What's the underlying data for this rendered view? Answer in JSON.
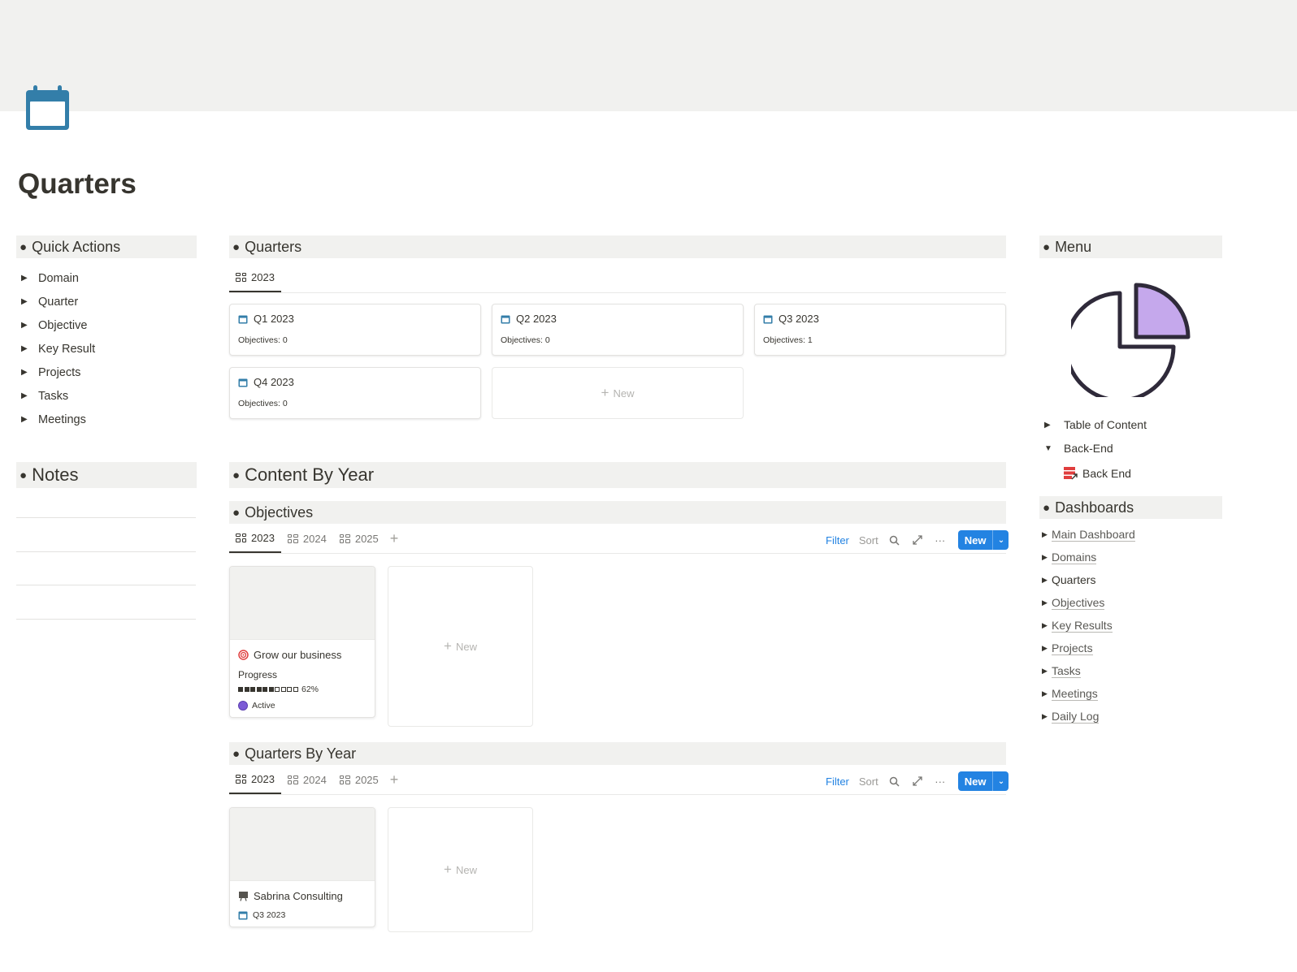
{
  "page": {
    "title": "Quarters",
    "icon": "calendar-icon"
  },
  "colors": {
    "accent": "#2383e2",
    "cover": "#f1f1ef",
    "calendar": "#337ea9",
    "active_status": "#7c5bd6",
    "target": "#e03e3e",
    "pie_fill": "#c5a8ec"
  },
  "quick_actions": {
    "heading": "Quick Actions",
    "items": [
      {
        "label": "Domain"
      },
      {
        "label": "Quarter"
      },
      {
        "label": "Objective"
      },
      {
        "label": "Key Result"
      },
      {
        "label": "Projects"
      },
      {
        "label": "Tasks"
      },
      {
        "label": "Meetings"
      }
    ]
  },
  "notes": {
    "heading": "Notes"
  },
  "quarters": {
    "heading": "Quarters",
    "tab": "2023",
    "cards": [
      {
        "title": "Q1 2023",
        "subtitle": "Objectives: 0"
      },
      {
        "title": "Q2 2023",
        "subtitle": "Objectives: 0"
      },
      {
        "title": "Q3 2023",
        "subtitle": "Objectives: 1"
      },
      {
        "title": "Q4 2023",
        "subtitle": "Objectives: 0"
      }
    ],
    "new_label": "New"
  },
  "content_by_year": {
    "heading": "Content By Year"
  },
  "objectives": {
    "heading": "Objectives",
    "tabs": [
      "2023",
      "2024",
      "2025"
    ],
    "toolbar": {
      "filter": "Filter",
      "sort": "Sort",
      "new": "New"
    },
    "card": {
      "title": "Grow our business",
      "progress_label": "Progress",
      "progress_value": 0.62,
      "progress_text": "62%",
      "status": "Active"
    },
    "new_label": "New"
  },
  "quarters_by_year": {
    "heading": "Quarters By Year",
    "tabs": [
      "2023",
      "2024",
      "2025"
    ],
    "toolbar": {
      "filter": "Filter",
      "sort": "Sort",
      "new": "New"
    },
    "card": {
      "title": "Sabrina Consulting",
      "quarter": "Q3 2023"
    },
    "new_label": "New"
  },
  "menu": {
    "heading": "Menu",
    "toggles": [
      {
        "label": "Table of Content",
        "expanded": false
      },
      {
        "label": "Back-End",
        "expanded": true
      }
    ],
    "backend_link": "Back End"
  },
  "dashboards": {
    "heading": "Dashboards",
    "items": [
      {
        "label": "Main Dashboard",
        "link": true
      },
      {
        "label": "Domains",
        "link": true
      },
      {
        "label": "Quarters",
        "link": false
      },
      {
        "label": "Objectives",
        "link": true
      },
      {
        "label": "Key Results",
        "link": true
      },
      {
        "label": "Projects",
        "link": true
      },
      {
        "label": "Tasks",
        "link": true
      },
      {
        "label": "Meetings",
        "link": true
      },
      {
        "label": "Daily Log",
        "link": true
      }
    ]
  }
}
